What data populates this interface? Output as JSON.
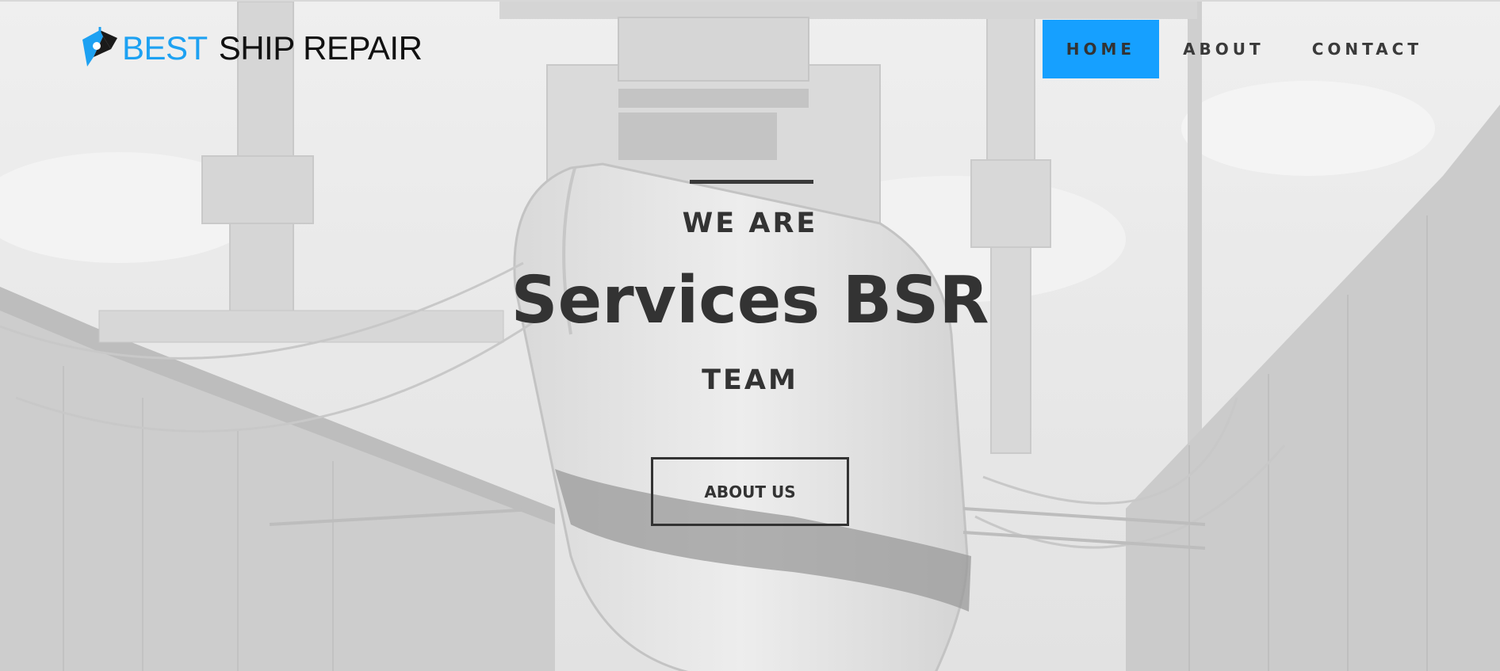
{
  "header": {
    "logo": {
      "word1": "BEST",
      "word2": "SHIP REPAIR",
      "brand_color": "#1da1f2"
    },
    "nav": [
      {
        "label": "HOME",
        "active": true
      },
      {
        "label": "ABOUT",
        "active": false
      },
      {
        "label": "CONTACT",
        "active": false
      }
    ],
    "accent_color": "#16a0ff"
  },
  "hero": {
    "kicker": "WE ARE",
    "headline": "Services BSR",
    "sub": "TEAM",
    "cta_label": "ABOUT US",
    "background": "grayscale shipyard dry dock photo"
  }
}
